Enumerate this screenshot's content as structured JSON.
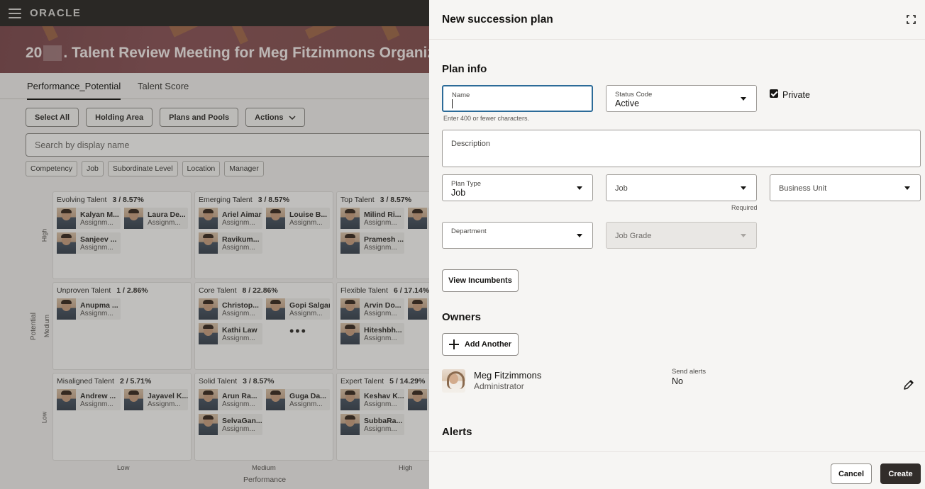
{
  "app": {
    "logo": "ORACLE",
    "banner_title_prefix": "20",
    "banner_title_suffix": ". Talent Review Meeting for Meg Fitzimmons Organiz"
  },
  "tabs": [
    "Performance_Potential",
    "Talent Score"
  ],
  "toolbar": {
    "select_all": "Select All",
    "holding_area": "Holding Area",
    "plans_pools": "Plans and Pools",
    "actions": "Actions"
  },
  "search": {
    "placeholder": "Search by display name"
  },
  "filters": [
    "Competency",
    "Job",
    "Subordinate Level",
    "Location",
    "Manager"
  ],
  "grid": {
    "y_axis_title": "Potential",
    "x_axis_title": "Performance",
    "y_levels": [
      "High",
      "Medium",
      "Low"
    ],
    "x_levels": [
      "Low",
      "Medium",
      "High"
    ],
    "cells": [
      {
        "title": "Evolving Talent",
        "stat": "3 / 8.57%",
        "people": [
          {
            "name": "Kalyan M...",
            "sub": "Assignm..."
          },
          {
            "name": "Laura De...",
            "sub": "Assignm..."
          },
          {
            "name": "Sanjeev ...",
            "sub": "Assignm..."
          }
        ]
      },
      {
        "title": "Emerging Talent",
        "stat": "3 / 8.57%",
        "people": [
          {
            "name": "Ariel Aimar",
            "sub": "Assignm..."
          },
          {
            "name": "Louise B...",
            "sub": "Assignm..."
          },
          {
            "name": "Ravikum...",
            "sub": "Assignm..."
          }
        ]
      },
      {
        "title": "Top Talent",
        "stat": "3 / 8.57%",
        "people": [
          {
            "name": "Milind Ri...",
            "sub": "Assignm..."
          },
          {
            "name": "",
            "sub": ""
          },
          {
            "name": "Pramesh ...",
            "sub": "Assignm..."
          }
        ]
      },
      {
        "title": "Unproven Talent",
        "stat": "1 / 2.86%",
        "people": [
          {
            "name": "Anupma ...",
            "sub": "Assignm..."
          }
        ]
      },
      {
        "title": "Core Talent",
        "stat": "8 / 22.86%",
        "people": [
          {
            "name": "Christop...",
            "sub": "Assignm..."
          },
          {
            "name": "Gopi Salgar",
            "sub": "Assignm..."
          },
          {
            "name": "Kathi Law",
            "sub": "Assignm..."
          }
        ],
        "more": "•••"
      },
      {
        "title": "Flexible Talent",
        "stat": "6 / 17.14%",
        "people": [
          {
            "name": "Arvin Do...",
            "sub": "Assignm..."
          },
          {
            "name": "",
            "sub": ""
          },
          {
            "name": "Hiteshbh...",
            "sub": "Assignm..."
          }
        ]
      },
      {
        "title": "Misaligned Talent",
        "stat": "2 / 5.71%",
        "people": [
          {
            "name": "Andrew ...",
            "sub": "Assignm..."
          },
          {
            "name": "Jayavel K...",
            "sub": "Assignm..."
          }
        ]
      },
      {
        "title": "Solid Talent",
        "stat": "3 / 8.57%",
        "people": [
          {
            "name": "Arun Ra...",
            "sub": "Assignm..."
          },
          {
            "name": "Guga Da...",
            "sub": "Assignm..."
          },
          {
            "name": "SelvaGan...",
            "sub": "Assignm..."
          }
        ]
      },
      {
        "title": "Expert Talent",
        "stat": "5 / 14.29%",
        "people": [
          {
            "name": "Keshav K...",
            "sub": "Assignm..."
          },
          {
            "name": "",
            "sub": ""
          },
          {
            "name": "SubbaRa...",
            "sub": "Assignm..."
          }
        ]
      }
    ]
  },
  "drawer": {
    "title": "New succession plan",
    "plan_info_title": "Plan info",
    "name": {
      "label": "Name",
      "value": "",
      "hint": "Enter 400 or fewer characters."
    },
    "status_code": {
      "label": "Status Code",
      "value": "Active"
    },
    "private": {
      "label": "Private",
      "checked": true
    },
    "description": {
      "label": "Description"
    },
    "plan_type": {
      "label": "Plan Type",
      "value": "Job"
    },
    "job": {
      "label": "Job",
      "hint": "Required"
    },
    "business_unit": {
      "label": "Business Unit"
    },
    "department": {
      "label": "Department"
    },
    "job_grade": {
      "label": "Job Grade"
    },
    "view_incumbents": "View Incumbents",
    "owners_title": "Owners",
    "add_another": "Add Another",
    "owner": {
      "name": "Meg Fitzimmons",
      "role": "Administrator",
      "send_alerts_label": "Send alerts",
      "send_alerts_value": "No"
    },
    "alerts_title": "Alerts",
    "cancel": "Cancel",
    "create": "Create"
  }
}
